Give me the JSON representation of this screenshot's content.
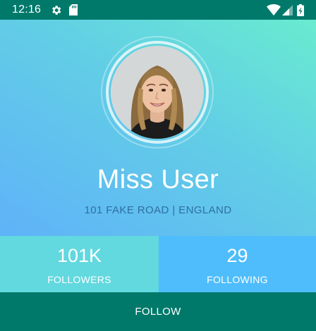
{
  "status_bar": {
    "time": "12:16",
    "icons": [
      "settings-gear-icon",
      "sd-card-icon",
      "wifi-icon",
      "cellular-signal-icon",
      "battery-charging-icon"
    ]
  },
  "profile": {
    "name": "Miss User",
    "address": "101 FAKE ROAD | ENGLAND",
    "avatar": "profile-photo"
  },
  "stats": {
    "followers": {
      "value": "101K",
      "label": "FOLLOWERS"
    },
    "following": {
      "value": "29",
      "label": "FOLLOWING"
    }
  },
  "actions": {
    "follow_label": "FOLLOW"
  },
  "colors": {
    "status_bar": "#00796b",
    "gradient_top_right": "#69ebd0",
    "gradient_bottom_left": "#5fb2f8",
    "followers_panel": "#62d8df",
    "following_panel": "#4fbdfc",
    "follow_button": "#00796b",
    "address_text": "#2e6fa0"
  }
}
